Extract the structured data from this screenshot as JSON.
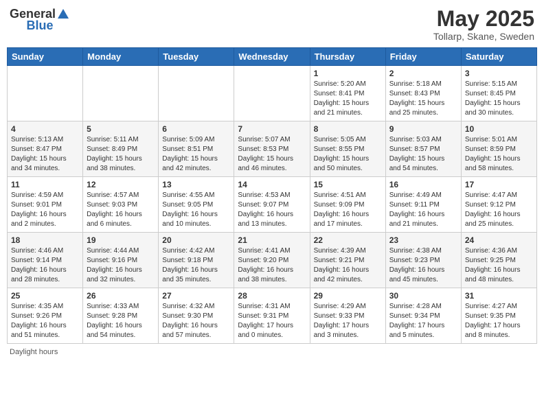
{
  "header": {
    "logo_general": "General",
    "logo_blue": "Blue",
    "month_title": "May 2025",
    "location": "Tollarp, Skane, Sweden"
  },
  "footer_note": "Daylight hours",
  "days_of_week": [
    "Sunday",
    "Monday",
    "Tuesday",
    "Wednesday",
    "Thursday",
    "Friday",
    "Saturday"
  ],
  "weeks": [
    [
      {
        "day": "",
        "info": ""
      },
      {
        "day": "",
        "info": ""
      },
      {
        "day": "",
        "info": ""
      },
      {
        "day": "",
        "info": ""
      },
      {
        "day": "1",
        "info": "Sunrise: 5:20 AM\nSunset: 8:41 PM\nDaylight: 15 hours\nand 21 minutes."
      },
      {
        "day": "2",
        "info": "Sunrise: 5:18 AM\nSunset: 8:43 PM\nDaylight: 15 hours\nand 25 minutes."
      },
      {
        "day": "3",
        "info": "Sunrise: 5:15 AM\nSunset: 8:45 PM\nDaylight: 15 hours\nand 30 minutes."
      }
    ],
    [
      {
        "day": "4",
        "info": "Sunrise: 5:13 AM\nSunset: 8:47 PM\nDaylight: 15 hours\nand 34 minutes."
      },
      {
        "day": "5",
        "info": "Sunrise: 5:11 AM\nSunset: 8:49 PM\nDaylight: 15 hours\nand 38 minutes."
      },
      {
        "day": "6",
        "info": "Sunrise: 5:09 AM\nSunset: 8:51 PM\nDaylight: 15 hours\nand 42 minutes."
      },
      {
        "day": "7",
        "info": "Sunrise: 5:07 AM\nSunset: 8:53 PM\nDaylight: 15 hours\nand 46 minutes."
      },
      {
        "day": "8",
        "info": "Sunrise: 5:05 AM\nSunset: 8:55 PM\nDaylight: 15 hours\nand 50 minutes."
      },
      {
        "day": "9",
        "info": "Sunrise: 5:03 AM\nSunset: 8:57 PM\nDaylight: 15 hours\nand 54 minutes."
      },
      {
        "day": "10",
        "info": "Sunrise: 5:01 AM\nSunset: 8:59 PM\nDaylight: 15 hours\nand 58 minutes."
      }
    ],
    [
      {
        "day": "11",
        "info": "Sunrise: 4:59 AM\nSunset: 9:01 PM\nDaylight: 16 hours\nand 2 minutes."
      },
      {
        "day": "12",
        "info": "Sunrise: 4:57 AM\nSunset: 9:03 PM\nDaylight: 16 hours\nand 6 minutes."
      },
      {
        "day": "13",
        "info": "Sunrise: 4:55 AM\nSunset: 9:05 PM\nDaylight: 16 hours\nand 10 minutes."
      },
      {
        "day": "14",
        "info": "Sunrise: 4:53 AM\nSunset: 9:07 PM\nDaylight: 16 hours\nand 13 minutes."
      },
      {
        "day": "15",
        "info": "Sunrise: 4:51 AM\nSunset: 9:09 PM\nDaylight: 16 hours\nand 17 minutes."
      },
      {
        "day": "16",
        "info": "Sunrise: 4:49 AM\nSunset: 9:11 PM\nDaylight: 16 hours\nand 21 minutes."
      },
      {
        "day": "17",
        "info": "Sunrise: 4:47 AM\nSunset: 9:12 PM\nDaylight: 16 hours\nand 25 minutes."
      }
    ],
    [
      {
        "day": "18",
        "info": "Sunrise: 4:46 AM\nSunset: 9:14 PM\nDaylight: 16 hours\nand 28 minutes."
      },
      {
        "day": "19",
        "info": "Sunrise: 4:44 AM\nSunset: 9:16 PM\nDaylight: 16 hours\nand 32 minutes."
      },
      {
        "day": "20",
        "info": "Sunrise: 4:42 AM\nSunset: 9:18 PM\nDaylight: 16 hours\nand 35 minutes."
      },
      {
        "day": "21",
        "info": "Sunrise: 4:41 AM\nSunset: 9:20 PM\nDaylight: 16 hours\nand 38 minutes."
      },
      {
        "day": "22",
        "info": "Sunrise: 4:39 AM\nSunset: 9:21 PM\nDaylight: 16 hours\nand 42 minutes."
      },
      {
        "day": "23",
        "info": "Sunrise: 4:38 AM\nSunset: 9:23 PM\nDaylight: 16 hours\nand 45 minutes."
      },
      {
        "day": "24",
        "info": "Sunrise: 4:36 AM\nSunset: 9:25 PM\nDaylight: 16 hours\nand 48 minutes."
      }
    ],
    [
      {
        "day": "25",
        "info": "Sunrise: 4:35 AM\nSunset: 9:26 PM\nDaylight: 16 hours\nand 51 minutes."
      },
      {
        "day": "26",
        "info": "Sunrise: 4:33 AM\nSunset: 9:28 PM\nDaylight: 16 hours\nand 54 minutes."
      },
      {
        "day": "27",
        "info": "Sunrise: 4:32 AM\nSunset: 9:30 PM\nDaylight: 16 hours\nand 57 minutes."
      },
      {
        "day": "28",
        "info": "Sunrise: 4:31 AM\nSunset: 9:31 PM\nDaylight: 17 hours\nand 0 minutes."
      },
      {
        "day": "29",
        "info": "Sunrise: 4:29 AM\nSunset: 9:33 PM\nDaylight: 17 hours\nand 3 minutes."
      },
      {
        "day": "30",
        "info": "Sunrise: 4:28 AM\nSunset: 9:34 PM\nDaylight: 17 hours\nand 5 minutes."
      },
      {
        "day": "31",
        "info": "Sunrise: 4:27 AM\nSunset: 9:35 PM\nDaylight: 17 hours\nand 8 minutes."
      }
    ]
  ]
}
